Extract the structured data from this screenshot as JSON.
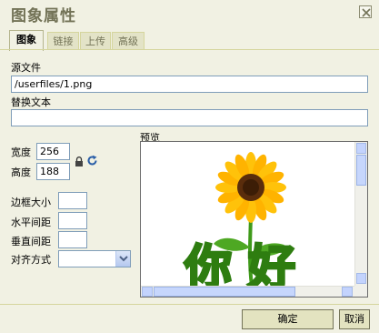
{
  "dialog": {
    "title": "图象属性",
    "close_glyph": "✕"
  },
  "tabs": [
    {
      "label": "图象",
      "active": true
    },
    {
      "label": "链接",
      "active": false
    },
    {
      "label": "上传",
      "active": false
    },
    {
      "label": "高级",
      "active": false
    }
  ],
  "form": {
    "source_label": "源文件",
    "source_value": "/userfiles/1.png",
    "alt_label": "替换文本",
    "alt_value": "",
    "width_label": "宽度",
    "width_value": "256",
    "height_label": "高度",
    "height_value": "188",
    "border_label": "边框大小",
    "border_value": "",
    "hspace_label": "水平间距",
    "hspace_value": "",
    "vspace_label": "垂直间距",
    "vspace_value": "",
    "align_label": "对齐方式",
    "align_value": ""
  },
  "preview": {
    "label": "预览",
    "caption": "你好"
  },
  "buttons": {
    "ok": "确定",
    "cancel": "取消"
  },
  "colors": {
    "title": "#737357",
    "background": "#f1f1e3",
    "caption_fill": "#9aca2e",
    "caption_outline": "#2e7d10",
    "petal": "#ffc20a",
    "seed": "#5a2d0c",
    "stem": "#3f9a1a"
  },
  "icons": [
    "close-icon",
    "lock-icon",
    "reset-size-icon",
    "chevron-down-icon",
    "sunflower-image"
  ]
}
